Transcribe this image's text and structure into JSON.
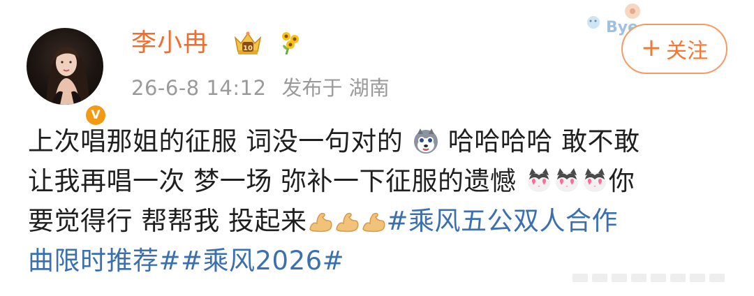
{
  "post": {
    "username": "李小冉",
    "timestamp": "26-6-8 14:12",
    "location": "发布于 湖南",
    "verified_mark": "V",
    "follow_plus": "+",
    "follow_label": "关注",
    "sticker_text": "Bye",
    "lines": {
      "l1a": "上次唱那姐的征服 词没一句对的",
      "l1b": "哈哈哈哈 敢不敢",
      "l2a": "让我再唱一次 梦一场 弥补一下征服的遗憾",
      "l2b": "你",
      "l3a": "要觉得行 帮帮我 投起来",
      "l3b": "#乘风五公双人合作",
      "l4": "曲限时推荐##乘风2026#"
    }
  },
  "colors": {
    "username": "#f26d2b",
    "meta": "#9a9a9a",
    "hashtag": "#3a6fb0",
    "follow": "#f57732",
    "badge": "#f39a12"
  },
  "icons": {
    "crown": "crown-level-icon",
    "flower": "sunflower-icon",
    "verify": "verified-v-icon",
    "husky": "husky-emoji",
    "cat": "cat-heart-emoji",
    "muscle": "muscle-emoji"
  }
}
